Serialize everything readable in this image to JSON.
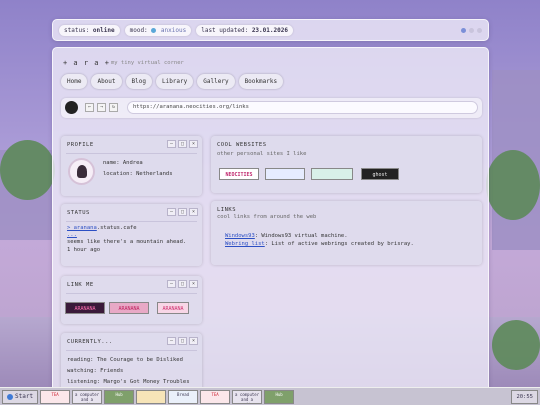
{
  "statusbar": {
    "status_label": "status:",
    "status_value": "online",
    "mood_label": "mood:",
    "mood_value": "anxious",
    "updated_label": "last updated:",
    "updated_value": "23.01.2026"
  },
  "header": {
    "site_title": "+ a r a +",
    "subtitle": "my tiny virtual corner"
  },
  "nav": [
    "Home",
    "About",
    "Blog",
    "Library",
    "Gallery",
    "Bookmarks"
  ],
  "urlbar": {
    "back": "←",
    "forward": "→",
    "reload": "↻",
    "url": "https://aranana.neocities.org/links"
  },
  "profile": {
    "title": "PROFILE",
    "name_label": "name:",
    "name_value": "Andrea",
    "location_label": "location:",
    "location_value": "Netherlands"
  },
  "status_panel": {
    "title": "STATUS",
    "link": "> aranana",
    "link_suffix": ".status.cafe",
    "link2": "...",
    "message": "seems like there's a mountain ahead.",
    "time": "1 hour ago"
  },
  "link_me": {
    "title": "LINK ME",
    "badges": [
      "ARANANA",
      "ARANANA",
      "ARANANA"
    ]
  },
  "currently": {
    "title": "CURRENTLY...",
    "reading_label": "reading:",
    "reading_value": "The Courage to be Disliked",
    "watching_label": "watching:",
    "watching_value": "Friends",
    "listening_label": "listening:",
    "listening_value": "Margo's Got Money Troubles"
  },
  "cool_websites": {
    "title": "COOL WEBSITES",
    "subtitle": "other personal sites I like",
    "badges": [
      "NEOCITIES",
      "",
      "",
      "ghost"
    ]
  },
  "links": {
    "title": "LINKS",
    "subtitle": "cool links from around the web",
    "items": [
      {
        "link": "Windows93",
        "desc": ": Windows93 virtual machine."
      },
      {
        "link": "Webring list",
        "desc": ": List of active webrings created by brisray."
      }
    ]
  },
  "window_controls": {
    "min": "–",
    "max": "□",
    "close": "×"
  },
  "taskbar": {
    "start_label": "Start",
    "items": [
      "TEA",
      "a computer and a monitor",
      "Hub",
      "",
      "Bread",
      "TEA",
      "a computer and a monitor",
      "Hub"
    ],
    "clock": "20:55"
  }
}
